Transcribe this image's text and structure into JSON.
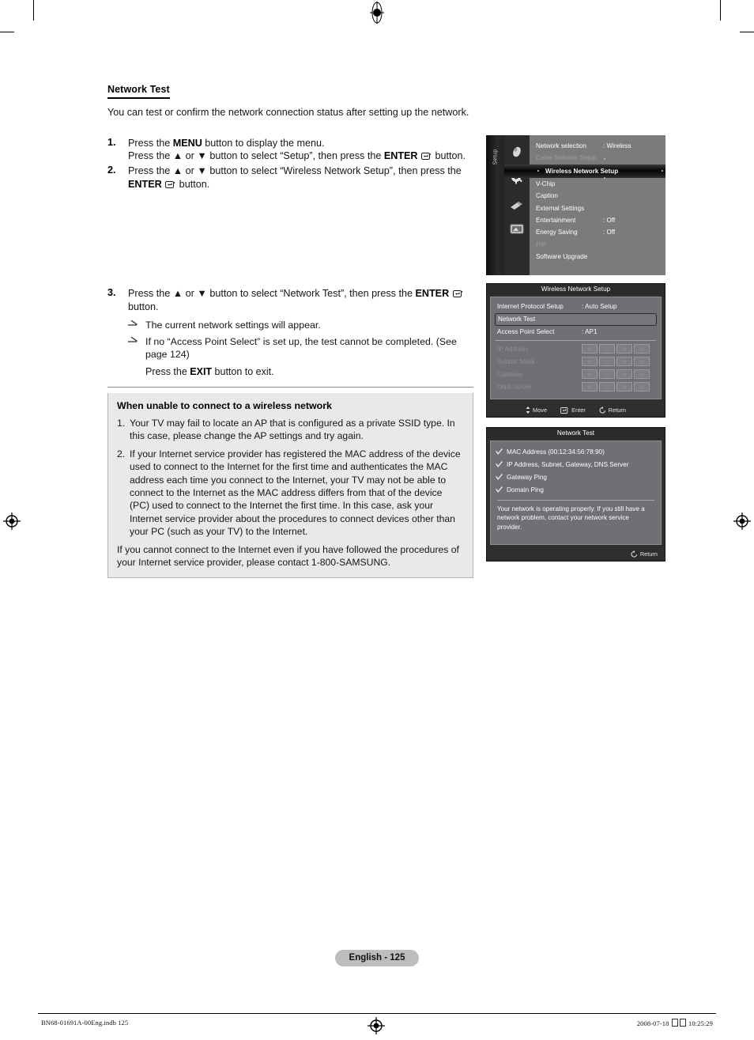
{
  "page": {
    "section_title": "Network Test",
    "intro": "You can test or confirm the network connection status after setting up the network.",
    "page_badge": "English - 125",
    "footer_left": "BN68-01691A-00Eng.indb   125",
    "footer_right_date": "2008-07-18",
    "footer_right_time": "10:25:29"
  },
  "steps": [
    {
      "num": "1.",
      "line1_a": "Press the ",
      "line1_key": "MENU",
      "line1_b": " button to display the menu.",
      "line2_a": "Press the ▲ or ▼ button to select “Setup”, then press the ",
      "line2_key": "ENTER",
      "line2_b": " button."
    },
    {
      "num": "2.",
      "line1_a": "Press the ▲ or ▼ button to select “Wireless Network Setup”, then press the ",
      "line1_key": "ENTER",
      "line1_b": " button."
    },
    {
      "num": "3.",
      "line1_a": "Press the ▲ or ▼ button to select “Network Test”, then press the ",
      "line1_key": "ENTER",
      "line1_b": " button.",
      "bullets": [
        "The current network settings will appear.",
        "If no “Access Point Select” is set up, the test cannot be completed. (See page 124)"
      ],
      "exit_a": "Press the ",
      "exit_key": "EXIT",
      "exit_b": " button to exit."
    }
  ],
  "infobox": {
    "title": "When unable to connect to a wireless network",
    "items": [
      {
        "num": "1.",
        "text": "Your TV may fail to locate an AP that is configured as a private SSID type. In this case, please change the AP settings and try again."
      },
      {
        "num": "2.",
        "text": "If your Internet service provider has registered the MAC address of the device used to connect to the Internet for the first time and authenticates the MAC address each time you connect to the Internet, your TV may not be able to connect to the Internet as the MAC address differs from that of the device (PC) used to connect to the Internet the first time. In this case, ask your Internet service provider about the procedures to connect devices other than your PC (such as your TV) to the Internet."
      }
    ],
    "footer": "If you cannot connect to the Internet even if you have followed the procedures of your Internet service provider, please contact 1-800-SAMSUNG."
  },
  "osd_menu": {
    "rail_label": "Setup",
    "icons": [
      "input-icon",
      "gear-icon",
      "remote-icon",
      "tv-icon"
    ],
    "rows": [
      {
        "label": "Network selection",
        "value": ": Wireless",
        "state": "normal"
      },
      {
        "label": "Cable Network Setup",
        "value": "",
        "state": "dim"
      },
      {
        "label": "Wireless Network Setup",
        "value": "",
        "state": "selected"
      },
      {
        "label": "V-Chip",
        "value": "",
        "state": "normal"
      },
      {
        "label": "Caption",
        "value": "",
        "state": "normal"
      },
      {
        "label": "External Settings",
        "value": "",
        "state": "normal"
      },
      {
        "label": "Entertainment",
        "value": ": Off",
        "state": "normal"
      },
      {
        "label": "Energy Saving",
        "value": ": Off",
        "state": "normal"
      },
      {
        "label": "PIP",
        "value": "",
        "state": "dim"
      },
      {
        "label": "Software Upgrade",
        "value": "",
        "state": "normal"
      }
    ]
  },
  "osd_wireless": {
    "title": "Wireless Network Setup",
    "rows": [
      {
        "label": "Internet Protocol Setup",
        "value": ": Auto Setup",
        "style": "normal"
      },
      {
        "label": "Network Test",
        "value": "",
        "style": "boxed"
      },
      {
        "label": "Access Point Select",
        "value": ": AP1",
        "style": "normal"
      }
    ],
    "octet_rows": [
      {
        "label": "IP Address",
        "octets": [
          "0",
          "0",
          "0",
          "0"
        ]
      },
      {
        "label": "Subnet Mask",
        "octets": [
          "0",
          "0",
          "0",
          "0"
        ]
      },
      {
        "label": "Gateway",
        "octets": [
          "0",
          "0",
          "0",
          "0"
        ]
      },
      {
        "label": "DNS Server",
        "octets": [
          "0",
          "0",
          "0",
          "0"
        ]
      }
    ],
    "footer": [
      {
        "icon": "updown-arrow-icon",
        "label": "Move"
      },
      {
        "icon": "enter-icon",
        "label": "Enter"
      },
      {
        "icon": "return-icon",
        "label": "Return"
      }
    ]
  },
  "osd_network_test": {
    "title": "Network Test",
    "checks": [
      "MAC Address (00:12:34:56:78:90)",
      "IP Address, Subnet, Gateway, DNS Server",
      "Gateway Ping",
      "Domain Ping"
    ],
    "message": "Your network is operating properly. If you still have a network problem, contact your network service provider.",
    "footer": [
      {
        "icon": "return-icon",
        "label": "Return"
      }
    ]
  },
  "colors": {
    "page_bg": "#ffffff",
    "infobox_bg": "#e9e9e9",
    "infobox_border": "#b5b5b5",
    "osd_menu_items_bg": "#7b7b7b",
    "osd_dialog_bg": "#2f2f2f",
    "osd_dialog_body_bg": "#6f6f74",
    "badge_bg": "#bdbdbd"
  }
}
